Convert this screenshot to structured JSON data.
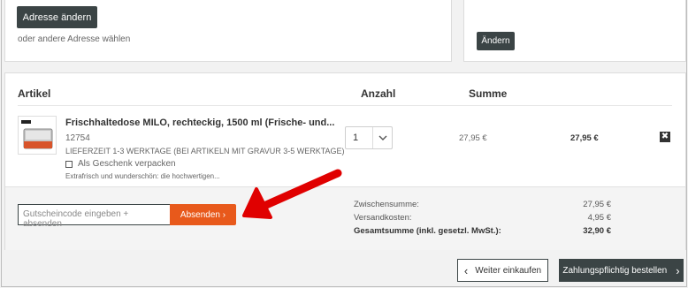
{
  "address": {
    "change_button": "Adresse ändern",
    "other_link": "oder andere Adresse wählen"
  },
  "right_box": {
    "change_button": "Ändern"
  },
  "table": {
    "headers": {
      "article": "Artikel",
      "qty": "Anzahl",
      "sum": "Summe"
    }
  },
  "item": {
    "title": "Frischhaltedose MILO, rechteckig, 1500 ml (Frische- und...",
    "sku": "12754",
    "delivery": "LIEFERZEIT 1-3 WERKTAGE (BEI ARTIKELN MIT GRAVUR 3-5 WERKTAGE)",
    "gift_label": "Als Geschenk verpacken",
    "desc": "Extrafrisch und wunderschön: die hochwertigen...",
    "qty": "1",
    "unit_price": "27,95 €",
    "total": "27,95 €",
    "remove_symbol": "✖"
  },
  "coupon": {
    "placeholder": "Gutscheincode eingeben + absenden",
    "submit": "Absenden ›"
  },
  "summary": {
    "subtotal_label": "Zwischensumme:",
    "subtotal_value": "27,95 €",
    "shipping_label": "Versandkosten:",
    "shipping_value": "4,95 €",
    "grand_label": "Gesamtsumme (inkl. gesetzl. MwSt.):",
    "grand_value": "32,90 €"
  },
  "actions": {
    "continue": "Weiter einkaufen",
    "checkout": "Zahlungspflichtig bestellen",
    "continue_arrow": "‹",
    "checkout_arrow": "›"
  },
  "colors": {
    "accent": "#e8591b",
    "dark_button": "#3b4445",
    "annotation_arrow": "#e00000"
  },
  "icons": {
    "qty_dropdown": "chevron-down-icon",
    "remove": "close-icon",
    "annotation": "red-arrow-icon"
  }
}
